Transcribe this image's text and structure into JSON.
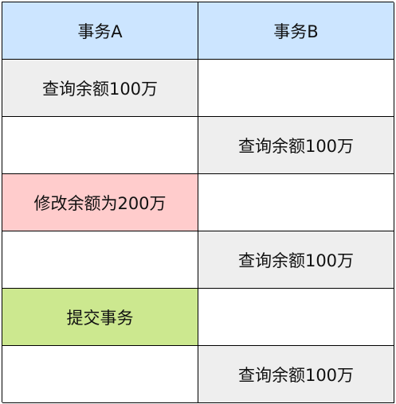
{
  "header": {
    "col_a": "事务A",
    "col_b": "事务B",
    "color": "#cce5ff"
  },
  "colors": {
    "gray": "#eeeeee",
    "red": "#ffcccc",
    "green": "#cce88f",
    "white": "#ffffff"
  },
  "rows": [
    {
      "a": "查询余额100万",
      "a_color": "gray",
      "b": "",
      "b_color": "white"
    },
    {
      "a": "",
      "a_color": "white",
      "b": "查询余额100万",
      "b_color": "gray"
    },
    {
      "a": "修改余额为200万",
      "a_color": "red",
      "b": "",
      "b_color": "white"
    },
    {
      "a": "",
      "a_color": "white",
      "b": "查询余额100万",
      "b_color": "gray"
    },
    {
      "a": "提交事务",
      "a_color": "green",
      "b": "",
      "b_color": "white"
    },
    {
      "a": "",
      "a_color": "white",
      "b": "查询余额100万",
      "b_color": "gray"
    }
  ]
}
